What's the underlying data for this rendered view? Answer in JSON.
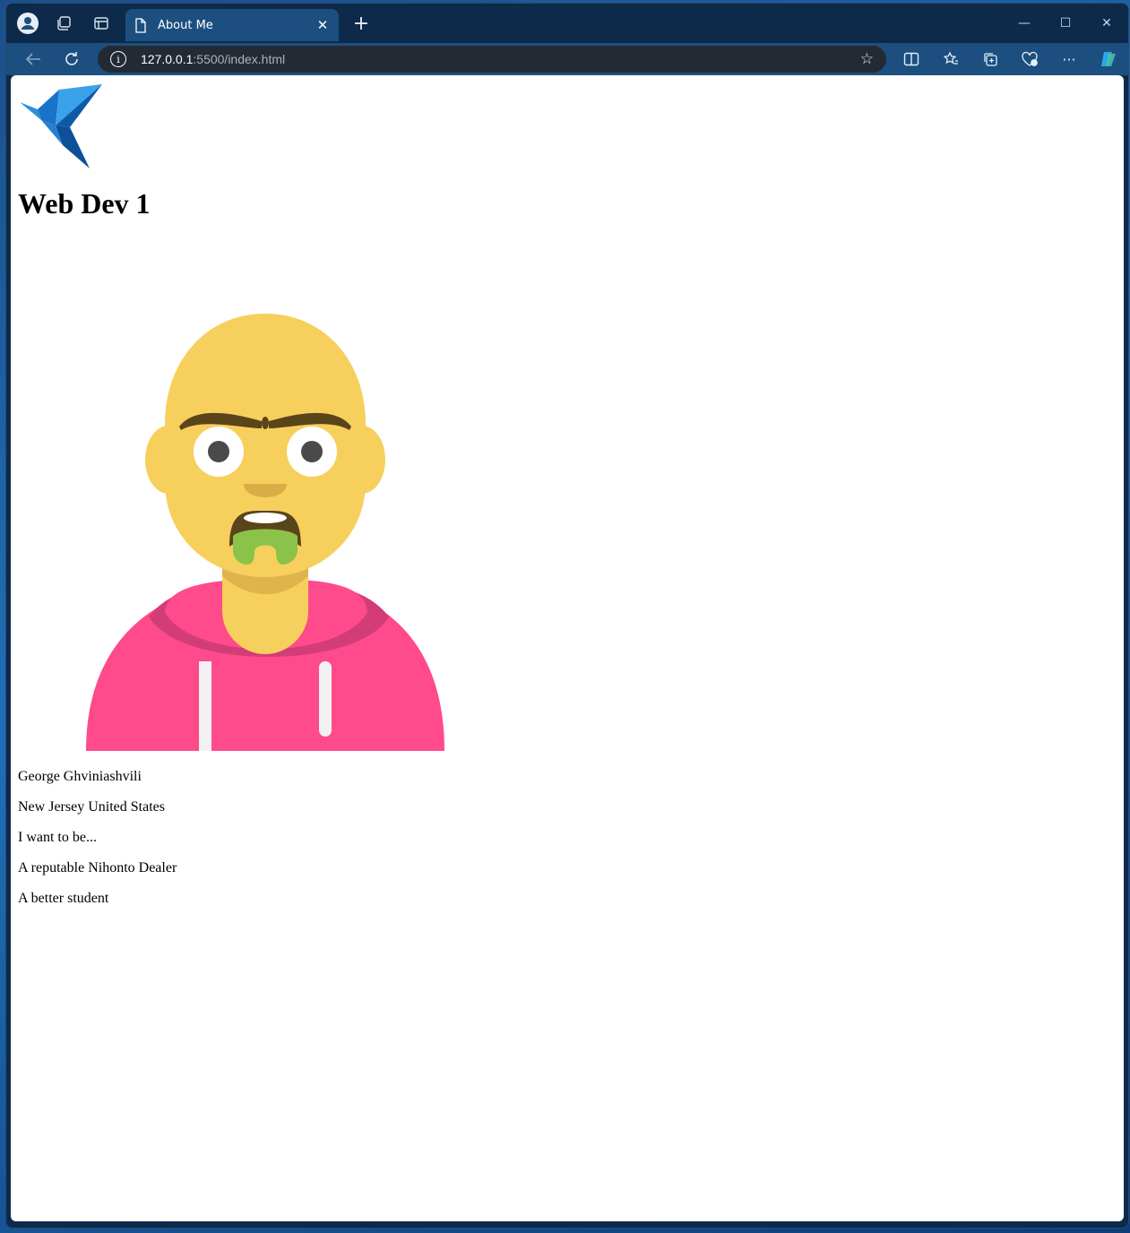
{
  "browser": {
    "tab_title": "About Me",
    "url_host": "127.0.0.1",
    "url_path": ":5500/index.html",
    "accent": "#1c4f80"
  },
  "page": {
    "heading": "Web Dev 1",
    "name": "George Ghviniashvili",
    "location": "New Jersey United States",
    "aspiration_intro": "I want to be...",
    "goals": [
      "A reputable Nihonto Dealer",
      "A better student"
    ]
  },
  "icons": {
    "logo": "blue-origami-bird-icon",
    "avatar": "cartoon-bald-man-hoodie-avatar"
  }
}
